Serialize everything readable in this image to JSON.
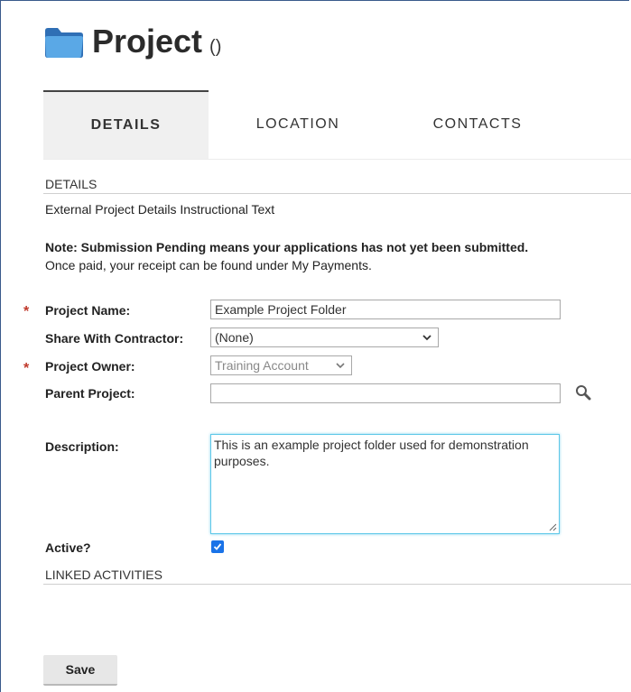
{
  "header": {
    "title": "Project",
    "count": "()"
  },
  "tabs": [
    {
      "label": "DETAILS",
      "active": true
    },
    {
      "label": "LOCATION",
      "active": false
    },
    {
      "label": "CONTACTS",
      "active": false
    }
  ],
  "details": {
    "section_label": "DETAILS",
    "instructional_text": "External Project Details Instructional Text",
    "note_bold": "Note: Submission Pending means your applications has not yet been submitted.",
    "note_plain": "Once paid, your receipt can be found under My Payments."
  },
  "form": {
    "required_marker": "*",
    "project_name": {
      "label": "Project Name:",
      "value": "Example Project Folder"
    },
    "share_with_contractor": {
      "label": "Share With Contractor:",
      "value": "(None)"
    },
    "project_owner": {
      "label": "Project Owner:",
      "value": "Training Account"
    },
    "parent_project": {
      "label": "Parent Project:",
      "value": ""
    },
    "description": {
      "label": "Description:",
      "value": "This is an example project folder used for demonstration purposes."
    },
    "active": {
      "label": "Active?",
      "checked": true
    }
  },
  "linked_activities": {
    "section_label": "LINKED ACTIVITIES"
  },
  "actions": {
    "save_label": "Save"
  },
  "colors": {
    "accent": "#1a73e8",
    "required": "#c0392b",
    "focus": "#5ec8e8"
  },
  "icons": {
    "folder": "folder-icon",
    "search": "search-icon",
    "chevron": "chevron-down-icon",
    "check": "check-icon"
  }
}
